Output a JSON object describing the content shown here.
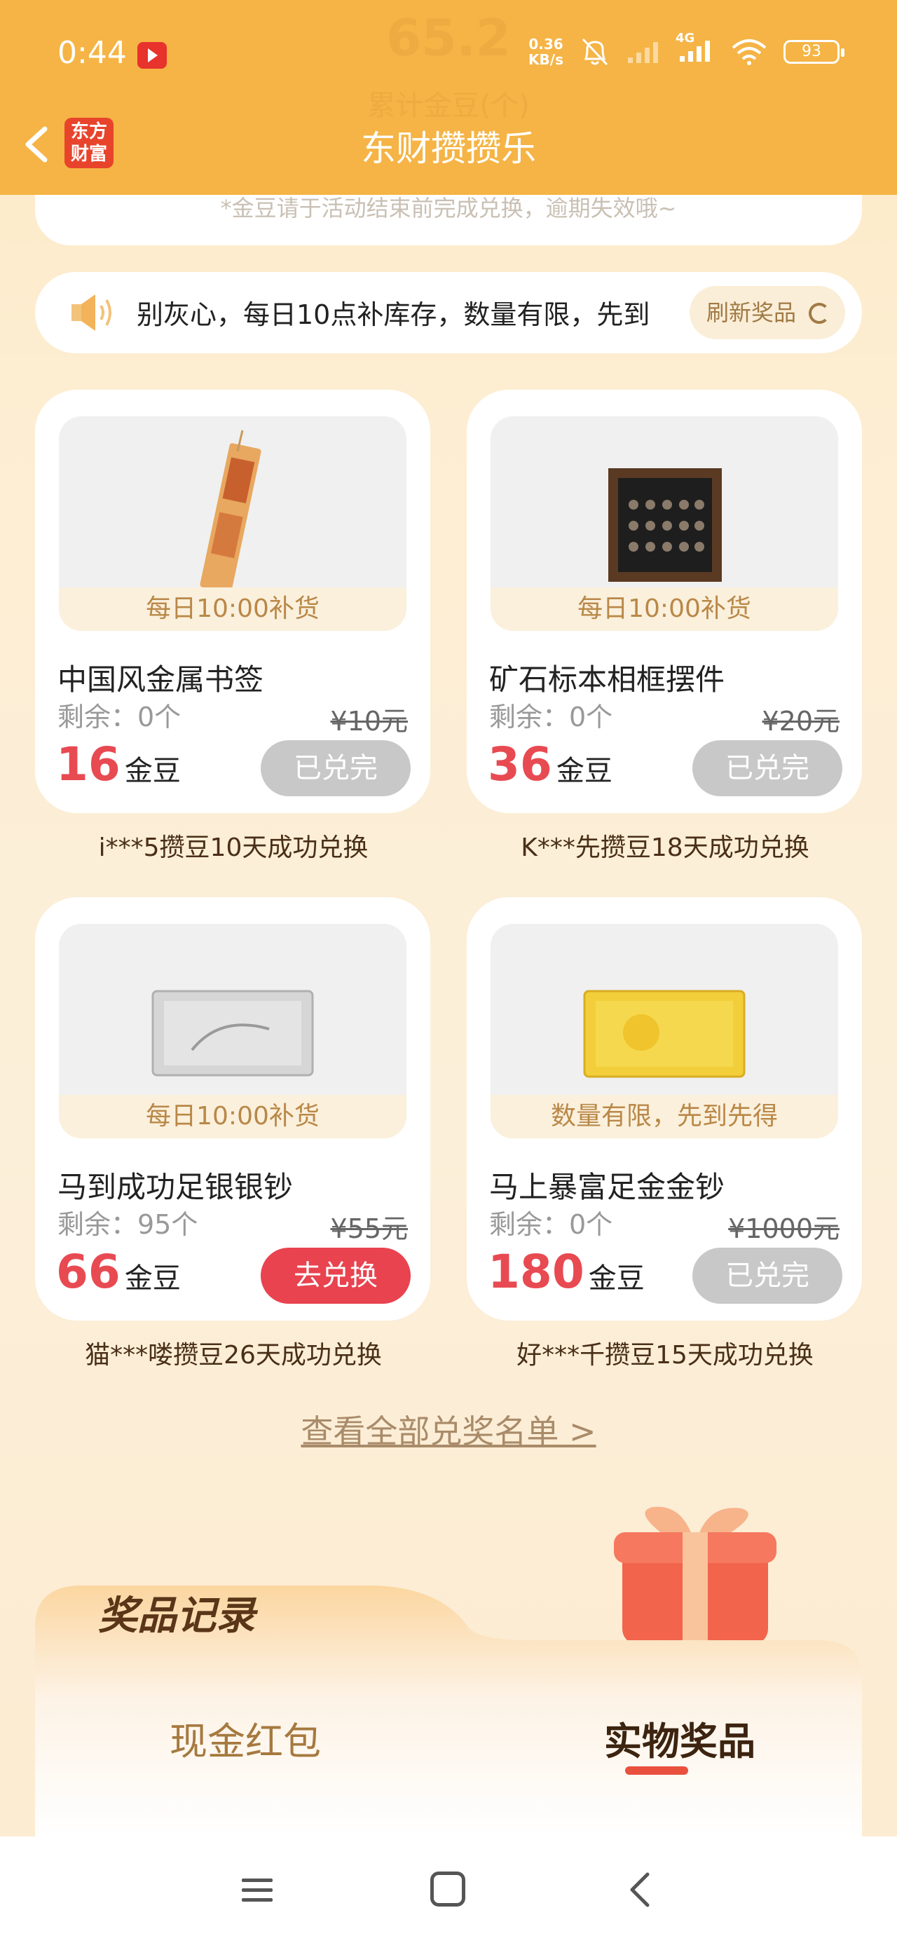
{
  "status_bar": {
    "time": "0:44",
    "net_speed_value": "0.36",
    "net_speed_unit": "KB/s",
    "network": "4G",
    "battery": "93"
  },
  "header": {
    "ghost_value": "65.2",
    "ghost_label": "累计金豆(个)",
    "logo_line1": "东方",
    "logo_line2": "财富",
    "title": "东财攒攒乐"
  },
  "top_card": {
    "note": "*金豆请于活动结束前完成兑换，逾期失效哦~"
  },
  "notice": {
    "text": "别灰心，每日10点补库存，数量有限，先到",
    "refresh_label": "刷新奖品"
  },
  "products": [
    {
      "name": "中国风金属书签",
      "badge": "每日10:00补货",
      "remaining": "剩余：0个",
      "original_price": "¥10元",
      "price": "16",
      "unit": "金豆",
      "button": "已兑完",
      "winner": "i***5攒豆10天成功兑换"
    },
    {
      "name": "矿石标本相框摆件",
      "badge": "每日10:00补货",
      "remaining": "剩余：0个",
      "original_price": "¥20元",
      "price": "36",
      "unit": "金豆",
      "button": "已兑完",
      "winner": "K***先攒豆18天成功兑换"
    },
    {
      "name": "马到成功足银银钞",
      "badge": "每日10:00补货",
      "remaining": "剩余：95个",
      "original_price": "¥55元",
      "price": "66",
      "unit": "金豆",
      "button": "去兑换",
      "winner": "猫***喽攒豆26天成功兑换"
    },
    {
      "name": "马上暴富足金金钞",
      "badge": "数量有限，先到先得",
      "remaining": "剩余：0个",
      "original_price": "¥1000元",
      "price": "180",
      "unit": "金豆",
      "button": "已兑完",
      "winner": "好***千攒豆15天成功兑换"
    }
  ],
  "view_all": "查看全部兑奖名单 >",
  "record": {
    "title": "奖品记录",
    "tab_cash": "现金红包",
    "tab_real": "实物奖品"
  },
  "colors": {
    "header": "#f5b445",
    "price_red": "#e84a52",
    "button_red": "#e8434f",
    "button_disabled": "#c8c8c8"
  }
}
